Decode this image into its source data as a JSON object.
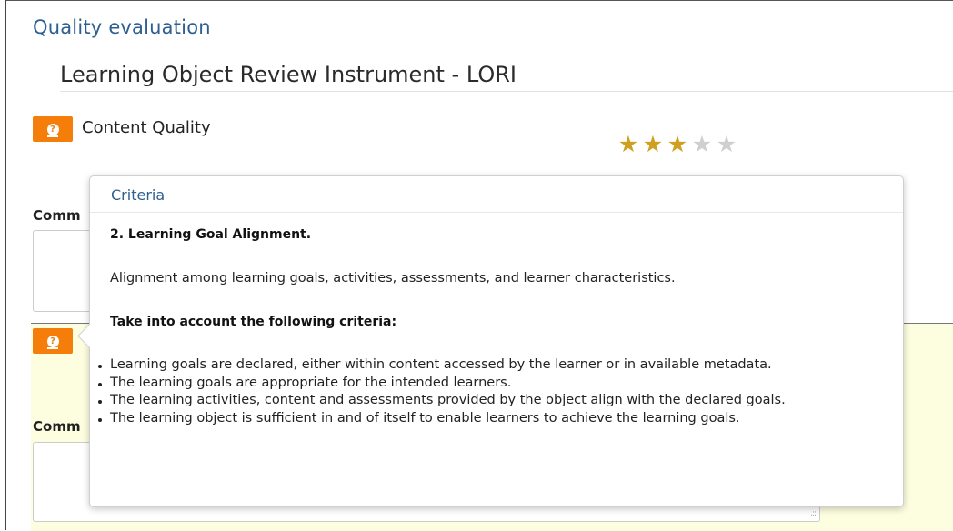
{
  "page": {
    "title": "Quality evaluation",
    "instrument_title": "Learning Object Review Instrument - LORI"
  },
  "content_quality": {
    "label": "Content Quality",
    "rating": 3,
    "max_rating": 5,
    "comments_label": "Comm"
  },
  "second_section": {
    "comments_label": "Comm"
  },
  "popover": {
    "header": "Criteria",
    "heading": "2. Learning Goal Alignment.",
    "description": "Alignment among learning goals, activities, assessments, and learner characteristics.",
    "subheading": "Take into account the following criteria:",
    "criteria": [
      "Learning goals are declared, either within content accessed by the learner or in available metadata.",
      "The learning goals are appropriate for the intended learners.",
      "The learning activities, content and assessments provided by the object align with the declared goals.",
      "The learning object is sufficient in and of itself to enable learners to achieve the learning goals."
    ]
  },
  "colors": {
    "accent_orange": "#f57e0b",
    "title_blue": "#2f5f8f",
    "star_on": "#cfa020",
    "star_off": "#cfcfcf",
    "highlight_yellow": "#fdfde0"
  },
  "icons": {
    "help": "question-circle-icon",
    "star": "star-icon",
    "resize": "resize-grip-icon"
  }
}
